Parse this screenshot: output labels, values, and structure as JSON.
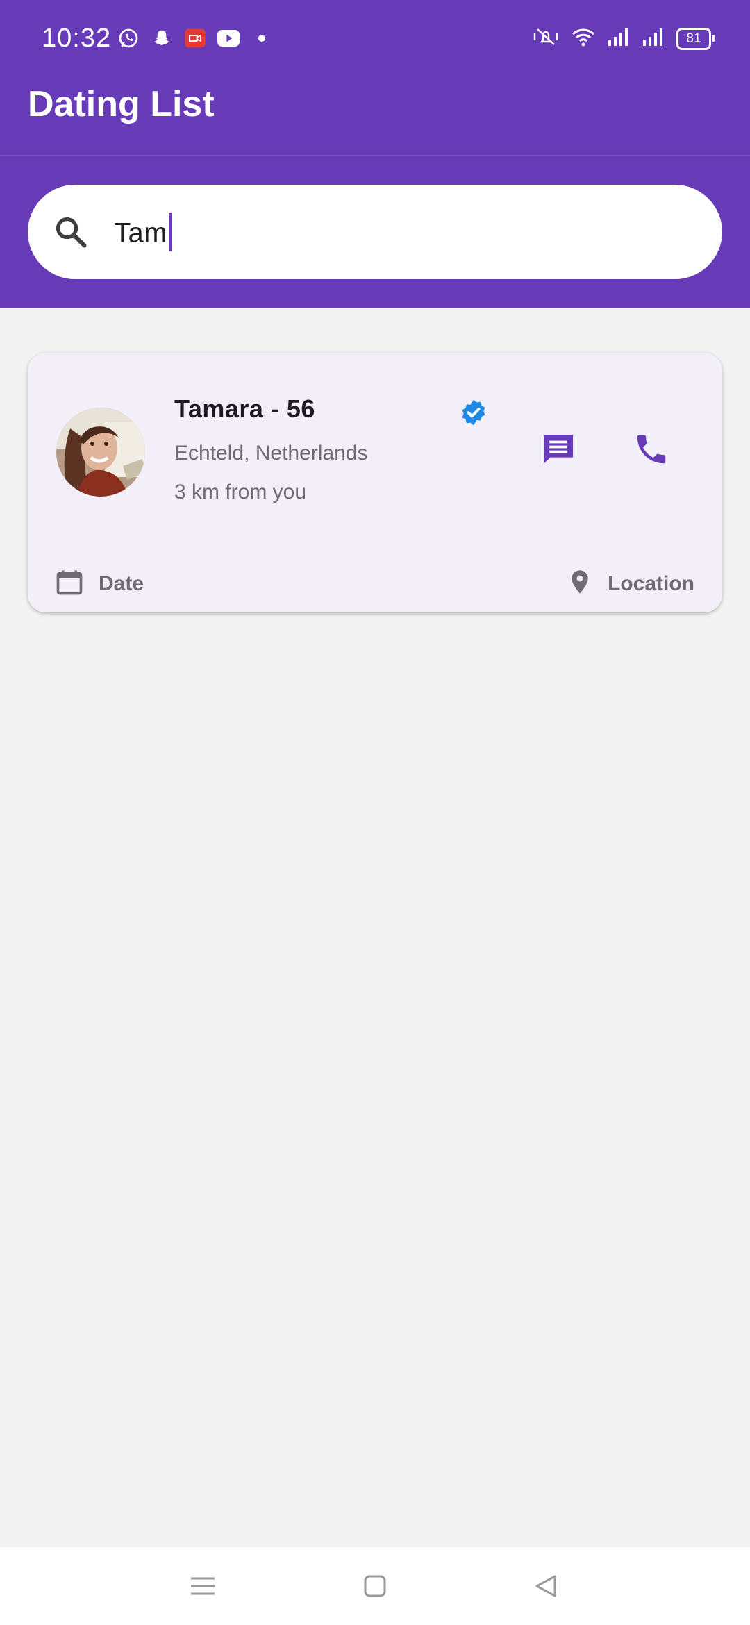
{
  "status_bar": {
    "time": "10:32",
    "battery": "81",
    "app_icons": [
      "whatsapp-icon",
      "snapchat-icon",
      "screen-recorder-icon",
      "youtube-icon",
      "dot-icon"
    ],
    "system_icons": [
      "mute-vibrate-icon",
      "wifi-icon",
      "signal-icon",
      "signal-icon"
    ]
  },
  "app_bar": {
    "title": "Dating List",
    "color": "#673ab7"
  },
  "search": {
    "value": "Tam",
    "icon": "search-icon"
  },
  "results": [
    {
      "name": "Tamara - 56",
      "verified": true,
      "location": "Echteld, Netherlands",
      "distance": "3 km from you",
      "actions": [
        "message-icon",
        "phone-icon"
      ],
      "footer_left": "Date",
      "footer_right": "Location"
    }
  ],
  "navigation": [
    "menu-icon",
    "home-icon",
    "back-icon"
  ]
}
